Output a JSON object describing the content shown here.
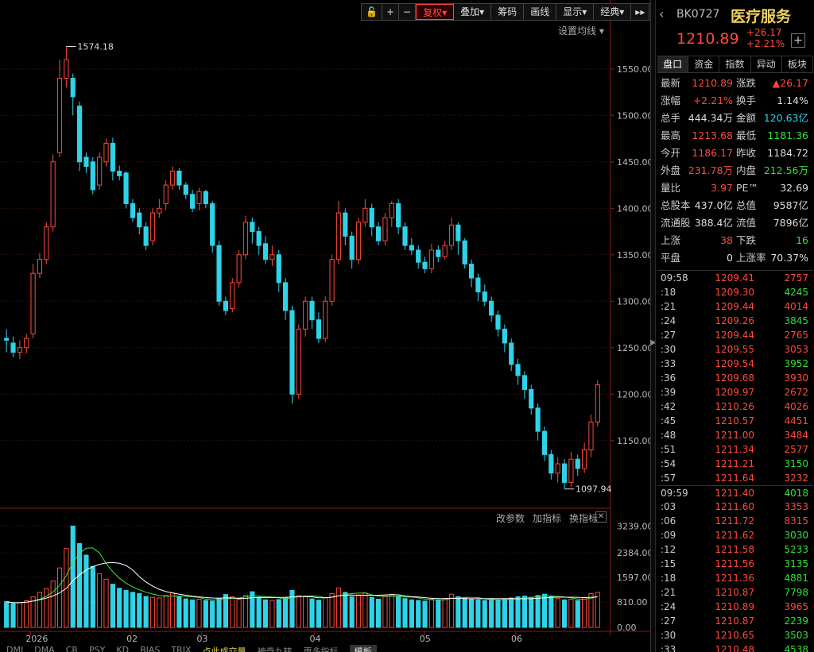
{
  "toolbar": {
    "lock_icon": "lock-icon",
    "plus_icon": "crosshair-plus-icon",
    "minus_icon": "minus-icon",
    "restore": "复权",
    "overlay": "叠加",
    "chips": "筹码",
    "draw": "画线",
    "display": "显示",
    "classic": "经典",
    "play_icon": "fast-forward-icon",
    "fullscreen_icon": "fullscreen-icon"
  },
  "settings_ma": "设置均线",
  "indicator_links": {
    "change_params": "改参数",
    "add_indicator": "加指标",
    "switch_indicator": "换指标"
  },
  "bottom_tabs": [
    "DMI",
    "DMA",
    "CR",
    "PSY",
    "KD",
    "BIAS",
    "TRIX",
    "点此成交量",
    "神奇九转",
    "更多指标",
    "模板"
  ],
  "price_axis": [
    "1550.00",
    "1500.00",
    "1450.00",
    "1400.00",
    "1350.00",
    "1300.00",
    "1250.00",
    "1200.00",
    "1150.00"
  ],
  "vol_axis": [
    "3239.00",
    "2384.00",
    "1597.00",
    "810.00",
    "0.00"
  ],
  "date_axis": [
    "2026",
    "02",
    "03",
    "04",
    "05",
    "06"
  ],
  "annotations": {
    "high": "1574.18",
    "low": "1097.94"
  },
  "colors": {
    "up": "#ff4a3a",
    "down": "#2fd3e8",
    "ma1": "#ffffff",
    "ma2": "#e8d24a",
    "ma3": "#3fe23f"
  },
  "chart_data": {
    "type": "candlestick",
    "ylim": [
      1090,
      1590
    ],
    "vol_ylim": [
      0,
      3300
    ],
    "candles": [
      [
        1260,
        1258,
        1270,
        1245
      ],
      [
        1255,
        1245,
        1262,
        1240
      ],
      [
        1245,
        1250,
        1258,
        1238
      ],
      [
        1250,
        1260,
        1265,
        1244
      ],
      [
        1265,
        1330,
        1340,
        1260
      ],
      [
        1330,
        1345,
        1352,
        1325
      ],
      [
        1345,
        1380,
        1385,
        1340
      ],
      [
        1380,
        1450,
        1458,
        1375
      ],
      [
        1460,
        1540,
        1560,
        1455
      ],
      [
        1540,
        1560,
        1574.18,
        1530
      ],
      [
        1540,
        1520,
        1545,
        1500
      ],
      [
        1510,
        1450,
        1515,
        1440
      ],
      [
        1455,
        1445,
        1460,
        1438
      ],
      [
        1450,
        1420,
        1455,
        1415
      ],
      [
        1425,
        1455,
        1460,
        1420
      ],
      [
        1450,
        1470,
        1475,
        1445
      ],
      [
        1470,
        1440,
        1476,
        1430
      ],
      [
        1440,
        1435,
        1446,
        1430
      ],
      [
        1438,
        1405,
        1440,
        1400
      ],
      [
        1405,
        1390,
        1410,
        1385
      ],
      [
        1395,
        1380,
        1400,
        1372
      ],
      [
        1380,
        1360,
        1385,
        1355
      ],
      [
        1365,
        1395,
        1400,
        1360
      ],
      [
        1395,
        1400,
        1410,
        1390
      ],
      [
        1405,
        1425,
        1430,
        1398
      ],
      [
        1425,
        1440,
        1445,
        1420
      ],
      [
        1440,
        1425,
        1443,
        1420
      ],
      [
        1425,
        1415,
        1428,
        1410
      ],
      [
        1415,
        1400,
        1420,
        1396
      ],
      [
        1405,
        1418,
        1422,
        1398
      ],
      [
        1418,
        1405,
        1420,
        1400
      ],
      [
        1405,
        1360,
        1408,
        1352
      ],
      [
        1360,
        1300,
        1365,
        1295
      ],
      [
        1300,
        1290,
        1305,
        1285
      ],
      [
        1292,
        1320,
        1325,
        1288
      ],
      [
        1320,
        1350,
        1355,
        1315
      ],
      [
        1350,
        1385,
        1392,
        1345
      ],
      [
        1385,
        1375,
        1390,
        1362
      ],
      [
        1375,
        1360,
        1380,
        1350
      ],
      [
        1362,
        1345,
        1370,
        1340
      ],
      [
        1345,
        1350,
        1360,
        1338
      ],
      [
        1350,
        1320,
        1355,
        1310
      ],
      [
        1320,
        1290,
        1325,
        1280
      ],
      [
        1290,
        1200,
        1295,
        1190
      ],
      [
        1200,
        1270,
        1275,
        1195
      ],
      [
        1270,
        1300,
        1305,
        1262
      ],
      [
        1300,
        1280,
        1305,
        1270
      ],
      [
        1280,
        1260,
        1288,
        1255
      ],
      [
        1260,
        1300,
        1305,
        1256
      ],
      [
        1300,
        1345,
        1350,
        1295
      ],
      [
        1345,
        1395,
        1408,
        1340
      ],
      [
        1395,
        1370,
        1400,
        1360
      ],
      [
        1370,
        1345,
        1375,
        1335
      ],
      [
        1345,
        1385,
        1390,
        1340
      ],
      [
        1385,
        1400,
        1410,
        1380
      ],
      [
        1400,
        1380,
        1405,
        1370
      ],
      [
        1380,
        1365,
        1385,
        1360
      ],
      [
        1365,
        1390,
        1395,
        1360
      ],
      [
        1390,
        1405,
        1408,
        1380
      ],
      [
        1405,
        1380,
        1410,
        1372
      ],
      [
        1380,
        1360,
        1385,
        1355
      ],
      [
        1360,
        1355,
        1368,
        1350
      ],
      [
        1355,
        1342,
        1360,
        1335
      ],
      [
        1342,
        1335,
        1348,
        1330
      ],
      [
        1335,
        1355,
        1362,
        1330
      ],
      [
        1355,
        1348,
        1360,
        1342
      ],
      [
        1348,
        1360,
        1365,
        1345
      ],
      [
        1360,
        1382,
        1390,
        1355
      ],
      [
        1382,
        1365,
        1385,
        1350
      ],
      [
        1365,
        1340,
        1368,
        1335
      ],
      [
        1340,
        1325,
        1345,
        1315
      ],
      [
        1325,
        1310,
        1330,
        1300
      ],
      [
        1310,
        1300,
        1318,
        1295
      ],
      [
        1300,
        1285,
        1305,
        1278
      ],
      [
        1285,
        1270,
        1290,
        1262
      ],
      [
        1270,
        1255,
        1275,
        1245
      ],
      [
        1255,
        1232,
        1260,
        1225
      ],
      [
        1232,
        1220,
        1238,
        1210
      ],
      [
        1220,
        1205,
        1225,
        1195
      ],
      [
        1205,
        1185,
        1210,
        1178
      ],
      [
        1185,
        1160,
        1190,
        1150
      ],
      [
        1160,
        1135,
        1165,
        1128
      ],
      [
        1135,
        1115,
        1140,
        1108
      ],
      [
        1115,
        1125,
        1132,
        1105
      ],
      [
        1125,
        1105,
        1130,
        1097.94
      ],
      [
        1105,
        1130,
        1138,
        1100
      ],
      [
        1130,
        1120,
        1135,
        1112
      ],
      [
        1120,
        1140,
        1148,
        1115
      ],
      [
        1140,
        1170,
        1178,
        1132
      ],
      [
        1170,
        1210,
        1215,
        1165
      ]
    ],
    "volumes": [
      820,
      760,
      790,
      850,
      980,
      1120,
      1240,
      1480,
      1900,
      2520,
      3239,
      2680,
      2310,
      1950,
      1720,
      1540,
      1380,
      1250,
      1180,
      1120,
      1080,
      990,
      960,
      940,
      1020,
      1100,
      980,
      910,
      880,
      900,
      860,
      840,
      920,
      1050,
      980,
      900,
      1020,
      1140,
      960,
      880,
      860,
      890,
      940,
      1180,
      1020,
      980,
      910,
      870,
      950,
      1080,
      1260,
      1120,
      980,
      1040,
      1100,
      960,
      900,
      980,
      1060,
      1000,
      920,
      880,
      860,
      840,
      900,
      880,
      920,
      1060,
      980,
      940,
      900,
      880,
      860,
      870,
      880,
      900,
      940,
      980,
      1000,
      960,
      1020,
      1060,
      980,
      920,
      880,
      900,
      860,
      950,
      1080,
      1120
    ]
  },
  "side": {
    "code": "BK0727",
    "name": "医疗服务",
    "price": "1210.89",
    "change": "+26.17",
    "change_pct": "+2.21%",
    "tabs": [
      "盘口",
      "资金",
      "指数",
      "异动",
      "板块"
    ],
    "quote": [
      [
        [
          "最新",
          "1210.89",
          "red"
        ],
        [
          "涨跌",
          "▲26.17",
          "red"
        ]
      ],
      [
        [
          "涨幅",
          "+2.21%",
          "red"
        ],
        [
          "换手",
          "1.14%",
          "white"
        ]
      ],
      [
        [
          "总手",
          "444.34万",
          "white"
        ],
        [
          "金额",
          "120.63亿",
          "cyan"
        ]
      ],
      [
        [
          "最高",
          "1213.68",
          "red"
        ],
        [
          "最低",
          "1181.36",
          "green"
        ]
      ],
      [
        [
          "今开",
          "1186.17",
          "red"
        ],
        [
          "昨收",
          "1184.72",
          "white"
        ]
      ],
      [
        [
          "外盘",
          "231.78万",
          "red"
        ],
        [
          "内盘",
          "212.56万",
          "green"
        ]
      ],
      [
        [
          "量比",
          "3.97",
          "red"
        ],
        [
          "PE™",
          "32.69",
          "white"
        ]
      ],
      [
        [
          "总股本",
          "437.0亿",
          "white"
        ],
        [
          "总值",
          "9587亿",
          "white"
        ]
      ],
      [
        [
          "流通股",
          "388.4亿",
          "white"
        ],
        [
          "流值",
          "7896亿",
          "white"
        ]
      ],
      [
        [
          "上涨",
          "38",
          "red"
        ],
        [
          "下跌",
          "16",
          "green"
        ]
      ],
      [
        [
          "平盘",
          "0",
          "white"
        ],
        [
          "上涨率",
          "70.37%",
          "white"
        ]
      ]
    ],
    "ticks": [
      [
        "09:58",
        "1209.41",
        "2757",
        "red"
      ],
      [
        ":18",
        "1209.30",
        "4245",
        "green"
      ],
      [
        ":21",
        "1209.44",
        "4014",
        "red"
      ],
      [
        ":24",
        "1209.26",
        "3845",
        "green"
      ],
      [
        ":27",
        "1209.44",
        "2765",
        "red"
      ],
      [
        ":30",
        "1209.55",
        "3053",
        "red"
      ],
      [
        ":33",
        "1209.54",
        "3952",
        "green"
      ],
      [
        ":36",
        "1209.68",
        "3930",
        "red"
      ],
      [
        ":39",
        "1209.97",
        "2672",
        "red"
      ],
      [
        ":42",
        "1210.26",
        "4026",
        "red"
      ],
      [
        ":45",
        "1210.57",
        "4451",
        "red"
      ],
      [
        ":48",
        "1211.00",
        "3484",
        "red"
      ],
      [
        ":51",
        "1211.34",
        "2577",
        "red"
      ],
      [
        ":54",
        "1211.21",
        "3150",
        "green"
      ],
      [
        ":57",
        "1211.64",
        "3232",
        "red"
      ],
      [
        "09:59",
        "1211.40",
        "4018",
        "green"
      ],
      [
        ":03",
        "1211.60",
        "3353",
        "red"
      ],
      [
        ":06",
        "1211.72",
        "8315",
        "red"
      ],
      [
        ":09",
        "1211.62",
        "3030",
        "green"
      ],
      [
        ":12",
        "1211.58",
        "5233",
        "green"
      ],
      [
        ":15",
        "1211.56",
        "3135",
        "green"
      ],
      [
        ":18",
        "1211.36",
        "4881",
        "green"
      ],
      [
        ":21",
        "1210.87",
        "7798",
        "green"
      ],
      [
        ":24",
        "1210.89",
        "3965",
        "red"
      ],
      [
        ":27",
        "1210.87",
        "2239",
        "green"
      ],
      [
        ":30",
        "1210.65",
        "3503",
        "green"
      ],
      [
        ":33",
        "1210.48",
        "4538",
        "green"
      ]
    ]
  }
}
